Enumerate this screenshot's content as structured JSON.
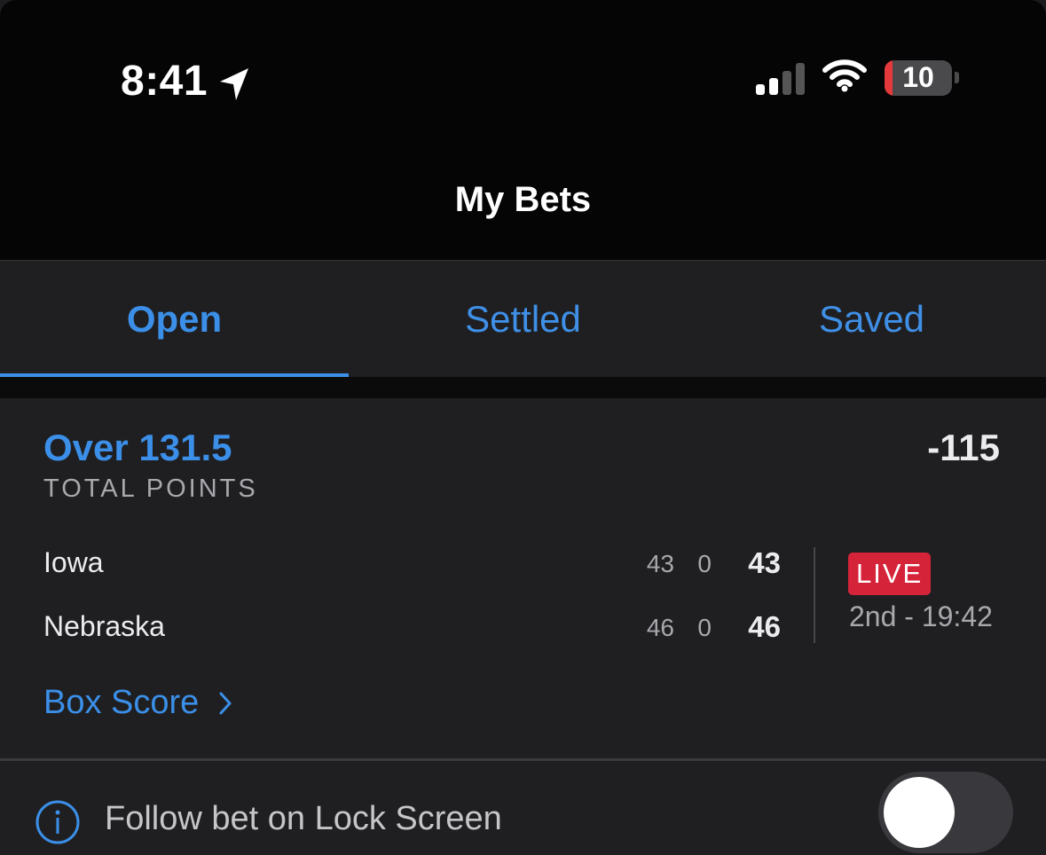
{
  "status_bar": {
    "time": "8:41",
    "battery": "10",
    "icons": [
      "location-arrow-icon",
      "cellular-signal-icon",
      "wifi-icon",
      "battery-icon"
    ]
  },
  "header": {
    "title": "My Bets"
  },
  "tabs": [
    {
      "label": "Open",
      "active": true
    },
    {
      "label": "Settled",
      "active": false
    },
    {
      "label": "Saved",
      "active": false
    }
  ],
  "bet": {
    "selection": "Over 131.5",
    "market": "TOTAL POINTS",
    "odds": "-115",
    "teams": [
      {
        "name": "Iowa",
        "first_half": "43",
        "second_half": "0",
        "total": "43"
      },
      {
        "name": "Nebraska",
        "first_half": "46",
        "second_half": "0",
        "total": "46"
      }
    ],
    "status_badge": "LIVE",
    "game_clock": "2nd - 19:42",
    "box_score_label": "Box Score"
  },
  "follow": {
    "label": "Follow bet on Lock Screen",
    "toggle_on": false
  },
  "colors": {
    "accent": "#3b8fe8",
    "live": "#d5243a",
    "background": "#1f1f21",
    "header": "#050505"
  }
}
